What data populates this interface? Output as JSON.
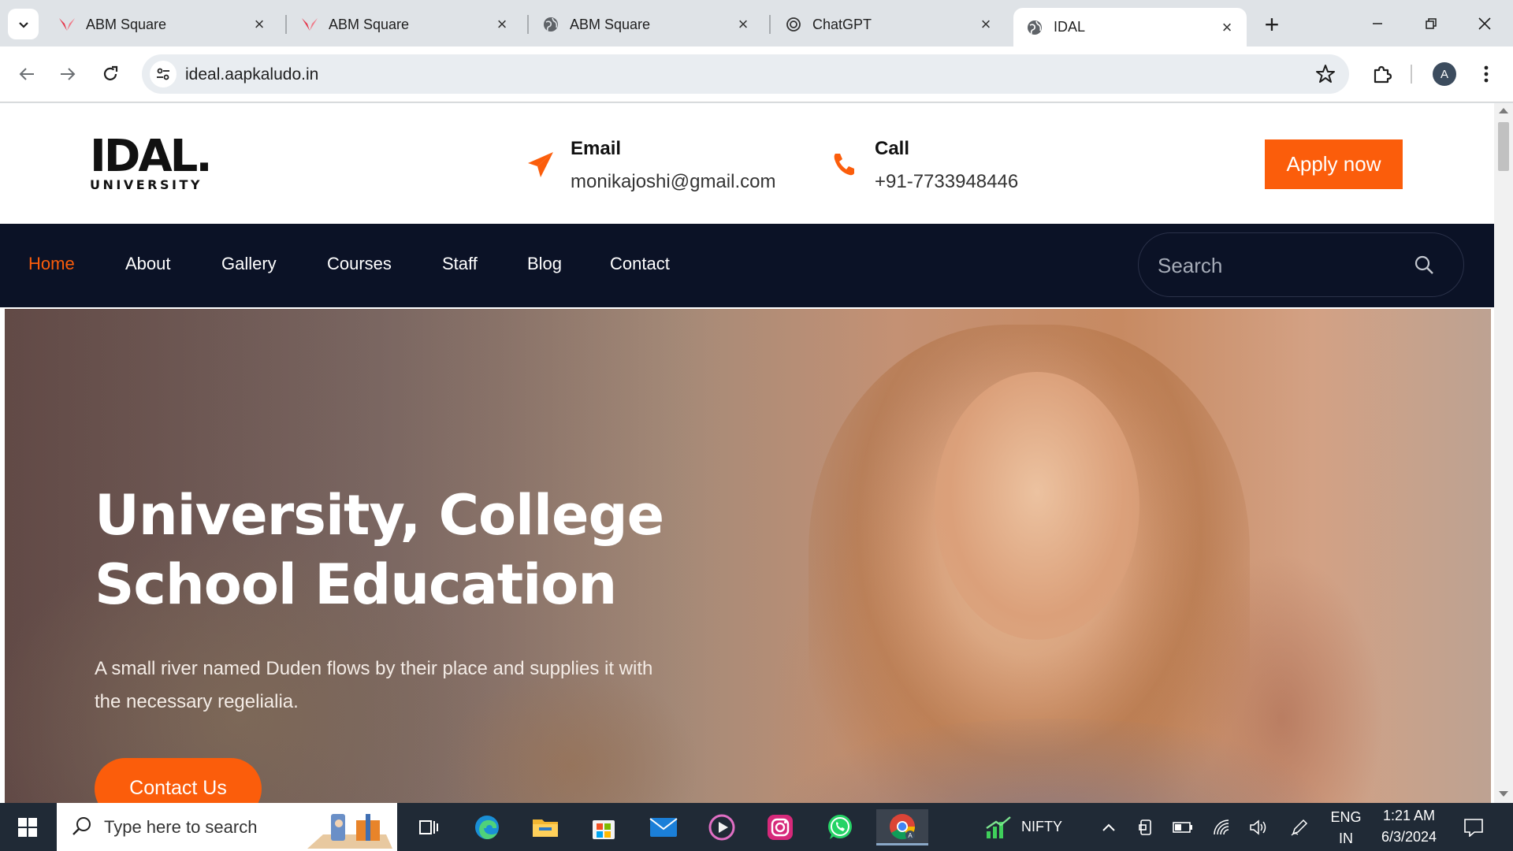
{
  "browser": {
    "tabs": [
      {
        "title": "ABM Square",
        "icon": "abm-logo-icon"
      },
      {
        "title": "ABM Square",
        "icon": "abm-logo-icon"
      },
      {
        "title": "ABM Square",
        "icon": "globe-icon"
      },
      {
        "title": "ChatGPT",
        "icon": "chatgpt-icon"
      },
      {
        "title": "IDAL",
        "icon": "globe-icon",
        "active": true
      }
    ],
    "url": "ideal.aapkaludo.in",
    "profile_initial": "A"
  },
  "site": {
    "logo_main": "IDAL.",
    "logo_sub": "UNIVERSITY",
    "email_label": "Email",
    "email_value": "monikajoshi@gmail.com",
    "call_label": "Call",
    "call_value": "+91-7733948446",
    "apply_label": "Apply now",
    "accent_color": "#fb5d0b",
    "nav_bg_color": "#0b1226",
    "nav": [
      {
        "label": "Home",
        "active": true
      },
      {
        "label": "About"
      },
      {
        "label": "Gallery"
      },
      {
        "label": "Courses"
      },
      {
        "label": "Staff"
      },
      {
        "label": "Blog"
      },
      {
        "label": "Contact"
      }
    ],
    "search_placeholder": "Search",
    "hero": {
      "title_line1": "University, College",
      "title_line2": "School Education",
      "text_line1": "A small river named Duden flows by their place and supplies it with",
      "text_line2": "the necessary regelialia.",
      "button": "Contact Us"
    }
  },
  "taskbar": {
    "search_placeholder": "Type here to search",
    "apps": [
      "task-view-icon",
      "edge-icon",
      "file-explorer-icon",
      "microsoft-store-icon",
      "mail-icon",
      "media-player-icon",
      "instagram-icon",
      "whatsapp-icon",
      "chrome-icon"
    ],
    "stock_label": "NIFTY",
    "language_line1": "ENG",
    "language_line2": "IN",
    "time": "1:21 AM",
    "date": "6/3/2024"
  }
}
